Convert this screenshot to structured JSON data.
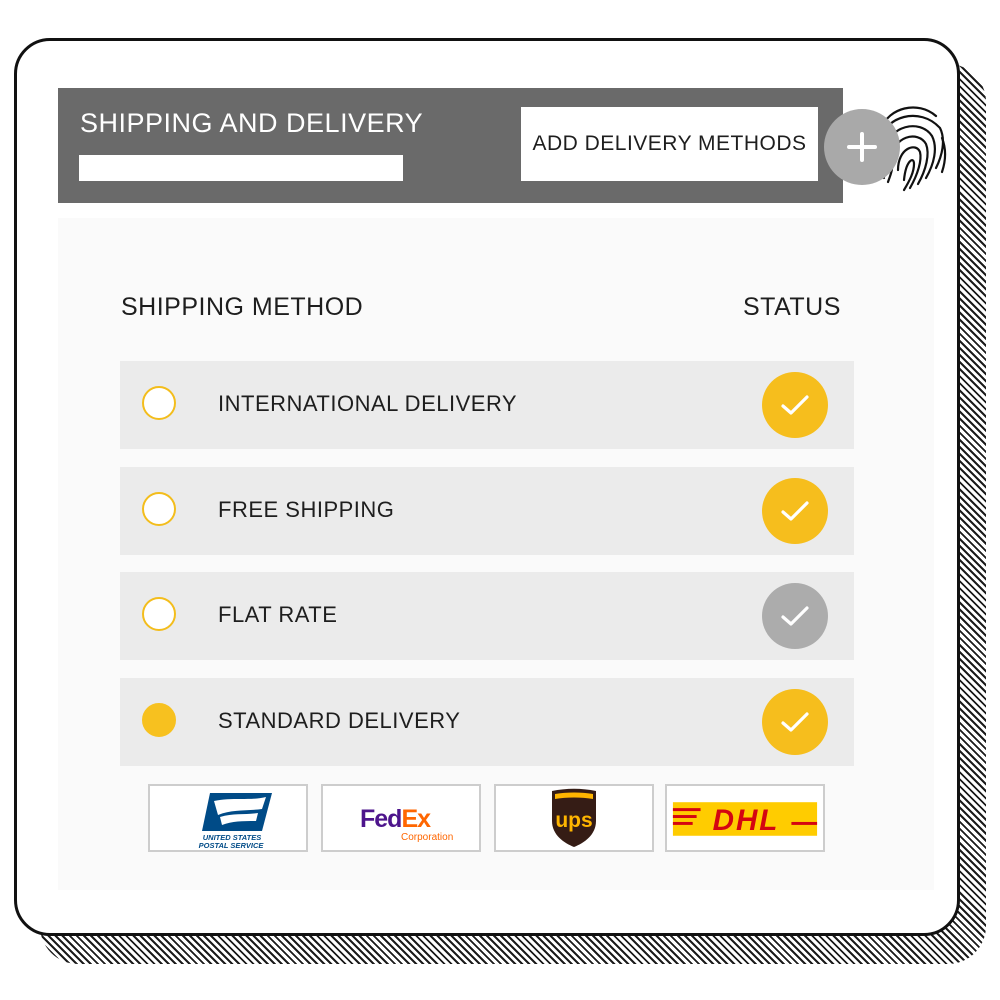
{
  "header": {
    "title": "SHIPPING AND DELIVERY",
    "add_button_label": "ADD DELIVERY METHODS"
  },
  "table": {
    "col_method": "SHIPPING METHOD",
    "col_status": "STATUS",
    "rows": [
      {
        "label": "INTERNATIONAL DELIVERY",
        "selected": false,
        "status": "enabled"
      },
      {
        "label": "FREE SHIPPING",
        "selected": false,
        "status": "enabled"
      },
      {
        "label": "FLAT RATE",
        "selected": false,
        "status": "disabled"
      },
      {
        "label": "STANDARD DELIVERY",
        "selected": true,
        "status": "enabled"
      }
    ]
  },
  "carriers": {
    "usps": {
      "line1": "UNITED STATES",
      "line2": "POSTAL SERVICE"
    },
    "fedex": {
      "fed": "Fed",
      "ex": "Ex",
      "sub": "Corporation"
    },
    "ups": {
      "text": "ups"
    },
    "dhl": {
      "text": "DHL"
    }
  },
  "colors": {
    "header_bg": "#6a6a6a",
    "accent_yellow": "#f6be1d",
    "status_off": "#acacac",
    "row_bg": "#ebebeb",
    "fedex_purple": "#4d148c",
    "fedex_orange": "#ff6600",
    "ups_brown": "#351c15",
    "ups_gold": "#ffb500",
    "dhl_red": "#d40511",
    "dhl_yellow": "#ffcc00",
    "usps_blue": "#004b87"
  },
  "icons": [
    "plus-icon",
    "check-icon",
    "fingerprint-icon"
  ]
}
